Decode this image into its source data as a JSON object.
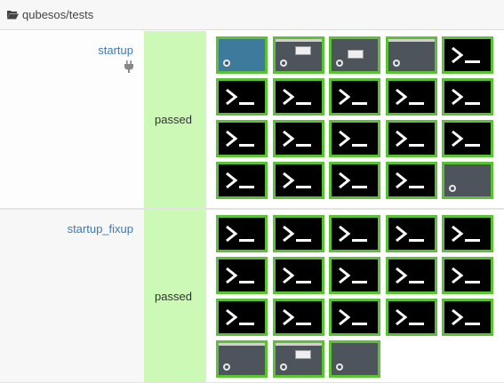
{
  "breadcrumb": {
    "path": "qubesos/tests",
    "icon": "folder-open-icon"
  },
  "colors": {
    "passed_bg": "#ccf9b5",
    "thumb_border": "#5bc236",
    "link": "#3a7ab8"
  },
  "tests": [
    {
      "name": "startup",
      "icon": "plug-icon",
      "result": "passed",
      "thumbnails": [
        "desktop-blue",
        "desktop-dialog",
        "desktop-dialog-small",
        "desktop-bar",
        "console",
        "console",
        "console",
        "console",
        "console",
        "console",
        "console",
        "console",
        "console",
        "console",
        "console",
        "console",
        "console",
        "console",
        "console",
        "desktop"
      ]
    },
    {
      "name": "startup_fixup",
      "result": "passed",
      "thumbnails": [
        "console",
        "console",
        "console",
        "console",
        "console",
        "console",
        "console",
        "console",
        "console",
        "console",
        "console",
        "console",
        "console",
        "console",
        "console",
        "desktop-bar",
        "desktop-dialog",
        "desktop"
      ]
    }
  ]
}
